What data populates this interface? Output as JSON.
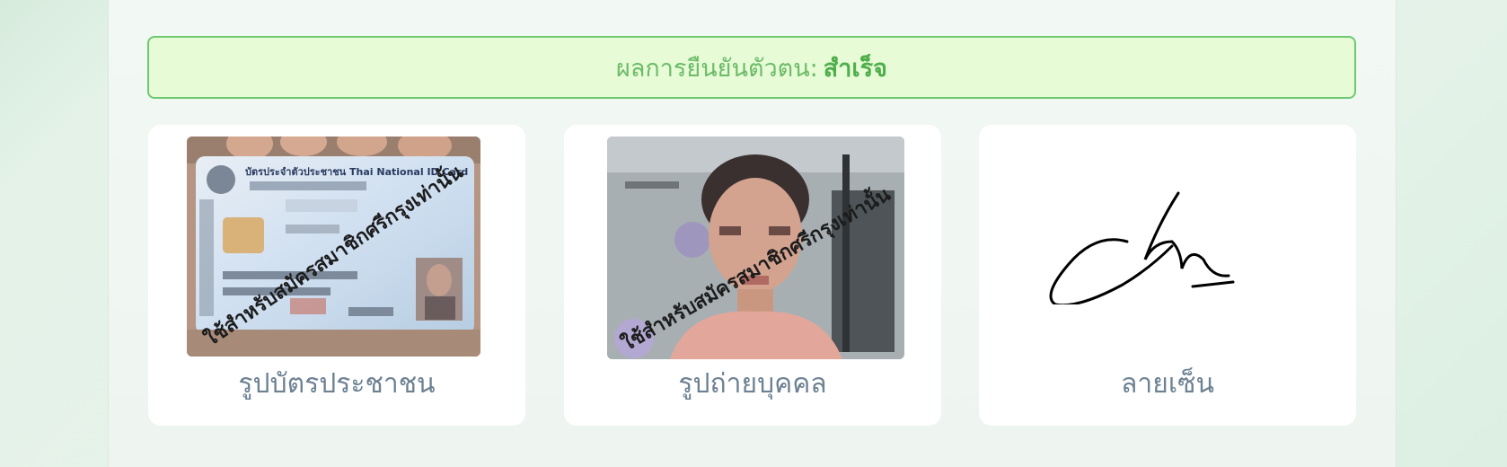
{
  "verification": {
    "label": "ผลการยืนยันตัวตน:",
    "status": "สำเร็จ"
  },
  "cards": [
    {
      "label": "รูปบัตรประชาชน",
      "watermark": "ใช้สำหรับสมัครสมาชิกศรีกรุงเท่านั้น",
      "card_title": "บัตรประจำตัวประชาชน Thai National ID Card"
    },
    {
      "label": "รูปถ่ายบุคคล",
      "watermark": "ใช้สำหรับสมัครสมาชิกศรีกรุงเท่านั้น"
    },
    {
      "label": "ลายเซ็น"
    }
  ],
  "colors": {
    "success_text": "#4fae4c",
    "banner_bg": "#e6fbd6",
    "banner_border": "#6fc971",
    "label_text": "#6d8192"
  }
}
